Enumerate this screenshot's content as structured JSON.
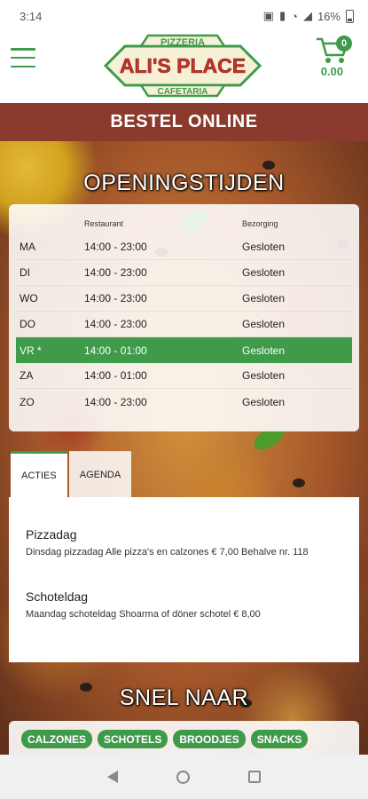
{
  "status": {
    "time": "3:14",
    "battery": "16%"
  },
  "header": {
    "logo_top": "PIZZERIA",
    "logo_main": "ALI'S PLACE",
    "logo_bottom": "CAFETARIA",
    "cart_count": "0",
    "cart_total": "0.00"
  },
  "order_bar": "BESTEL ONLINE",
  "hours": {
    "title": "OPENINGSTIJDEN",
    "col_restaurant": "Restaurant",
    "col_delivery": "Bezorging",
    "rows": [
      {
        "day": "MA",
        "restaurant": "14:00 - 23:00",
        "delivery": "Gesloten"
      },
      {
        "day": "DI",
        "restaurant": "14:00 - 23:00",
        "delivery": "Gesloten"
      },
      {
        "day": "WO",
        "restaurant": "14:00 - 23:00",
        "delivery": "Gesloten"
      },
      {
        "day": "DO",
        "restaurant": "14:00 - 23:00",
        "delivery": "Gesloten"
      },
      {
        "day": "VR *",
        "restaurant": "14:00 - 01:00",
        "delivery": "Gesloten"
      },
      {
        "day": "ZA",
        "restaurant": "14:00 - 01:00",
        "delivery": "Gesloten"
      },
      {
        "day": "ZO",
        "restaurant": "14:00 - 23:00",
        "delivery": "Gesloten"
      }
    ]
  },
  "tabs": {
    "acties": "ACTIES",
    "agenda": "AGENDA"
  },
  "actions": [
    {
      "title": "Pizzadag",
      "text": "Dinsdag pizzadag Alle pizza's en calzones € 7,00 Behalve nr. 118"
    },
    {
      "title": "Schoteldag",
      "text": "Maandag schoteldag Shoarma of döner schotel € 8,00"
    }
  ],
  "quick_links": {
    "title": "SNEL NAAR",
    "items": [
      "CALZONES",
      "SCHOTELS",
      "BROODJES",
      "SNACKS"
    ]
  },
  "colors": {
    "brand_green": "#3f9a4a",
    "order_bar": "#8b3a2e"
  }
}
